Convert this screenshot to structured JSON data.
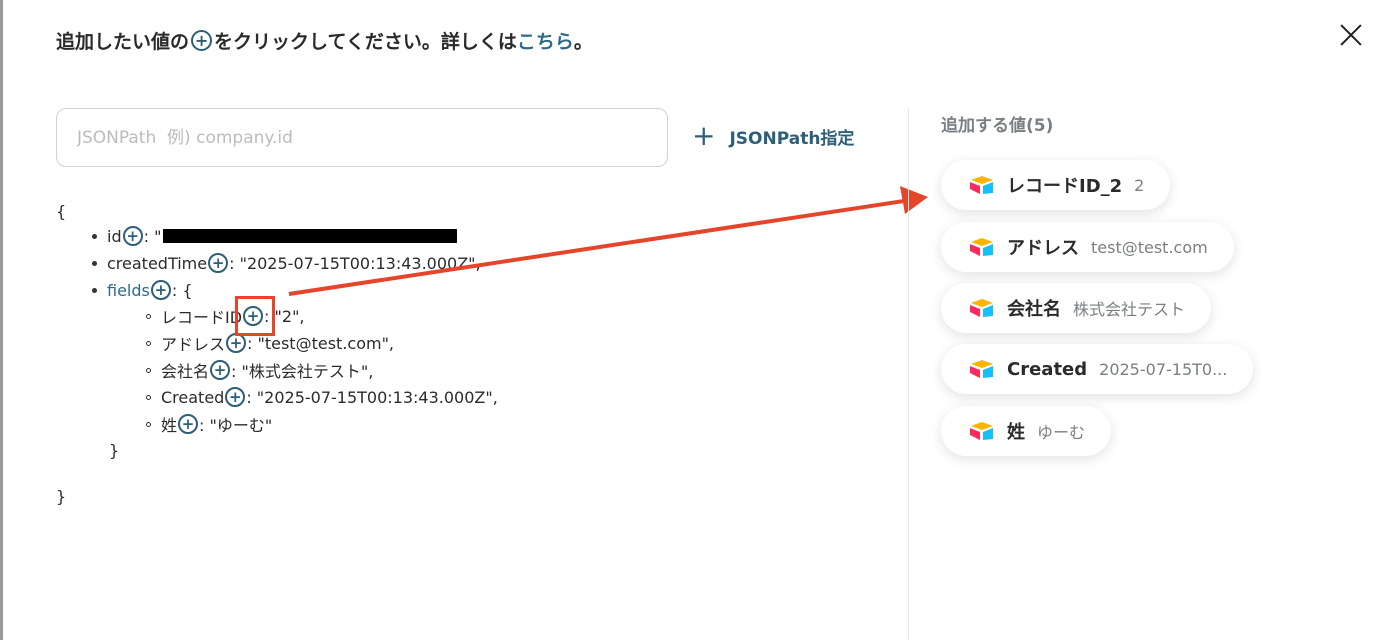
{
  "header": {
    "text_before": "追加したい値の",
    "plus_symbol": "+",
    "text_after": "をクリックしてください。詳しくは",
    "link_text": "こちら",
    "text_end": "。"
  },
  "search": {
    "placeholder": "JSONPath  例) company.id",
    "value": ""
  },
  "jsonpath_button": {
    "icon": "plus-icon",
    "label": "JSONPath指定"
  },
  "tree": {
    "open_brace": "{",
    "close_brace": "}",
    "id": {
      "key": "id",
      "value": ": \""
    },
    "createdTime": {
      "key": "createdTime",
      "value": ": \"2025-07-15T00:13:43.000Z\","
    },
    "fields": {
      "key": "fields",
      "value": ": {",
      "close": "}",
      "items": [
        {
          "key": "レコードID",
          "value": ": \"2\","
        },
        {
          "key": "アドレス",
          "value": ": \"test@test.com\","
        },
        {
          "key": "会社名",
          "value": ": \"株式会社テスト\","
        },
        {
          "key": "Created",
          "value": ": \"2025-07-15T00:13:43.000Z\","
        },
        {
          "key": "姓",
          "value": ": \"ゆーむ\""
        }
      ]
    }
  },
  "right_panel": {
    "title": "追加する値(5)",
    "chips": [
      {
        "key": "レコードID_2",
        "value": "2"
      },
      {
        "key": "アドレス",
        "value": "test@test.com"
      },
      {
        "key": "会社名",
        "value": "株式会社テスト"
      },
      {
        "key": "Created",
        "value": "2025-07-15T0..."
      },
      {
        "key": "姓",
        "value": "ゆーむ"
      }
    ]
  },
  "colors": {
    "accent": "#2e5f78",
    "link": "#2e6a8a",
    "annotation": "#e5452a"
  },
  "icons": {
    "close": "close-icon",
    "add": "plus-circle-icon",
    "chip_logo": "airtable-logo-icon"
  }
}
